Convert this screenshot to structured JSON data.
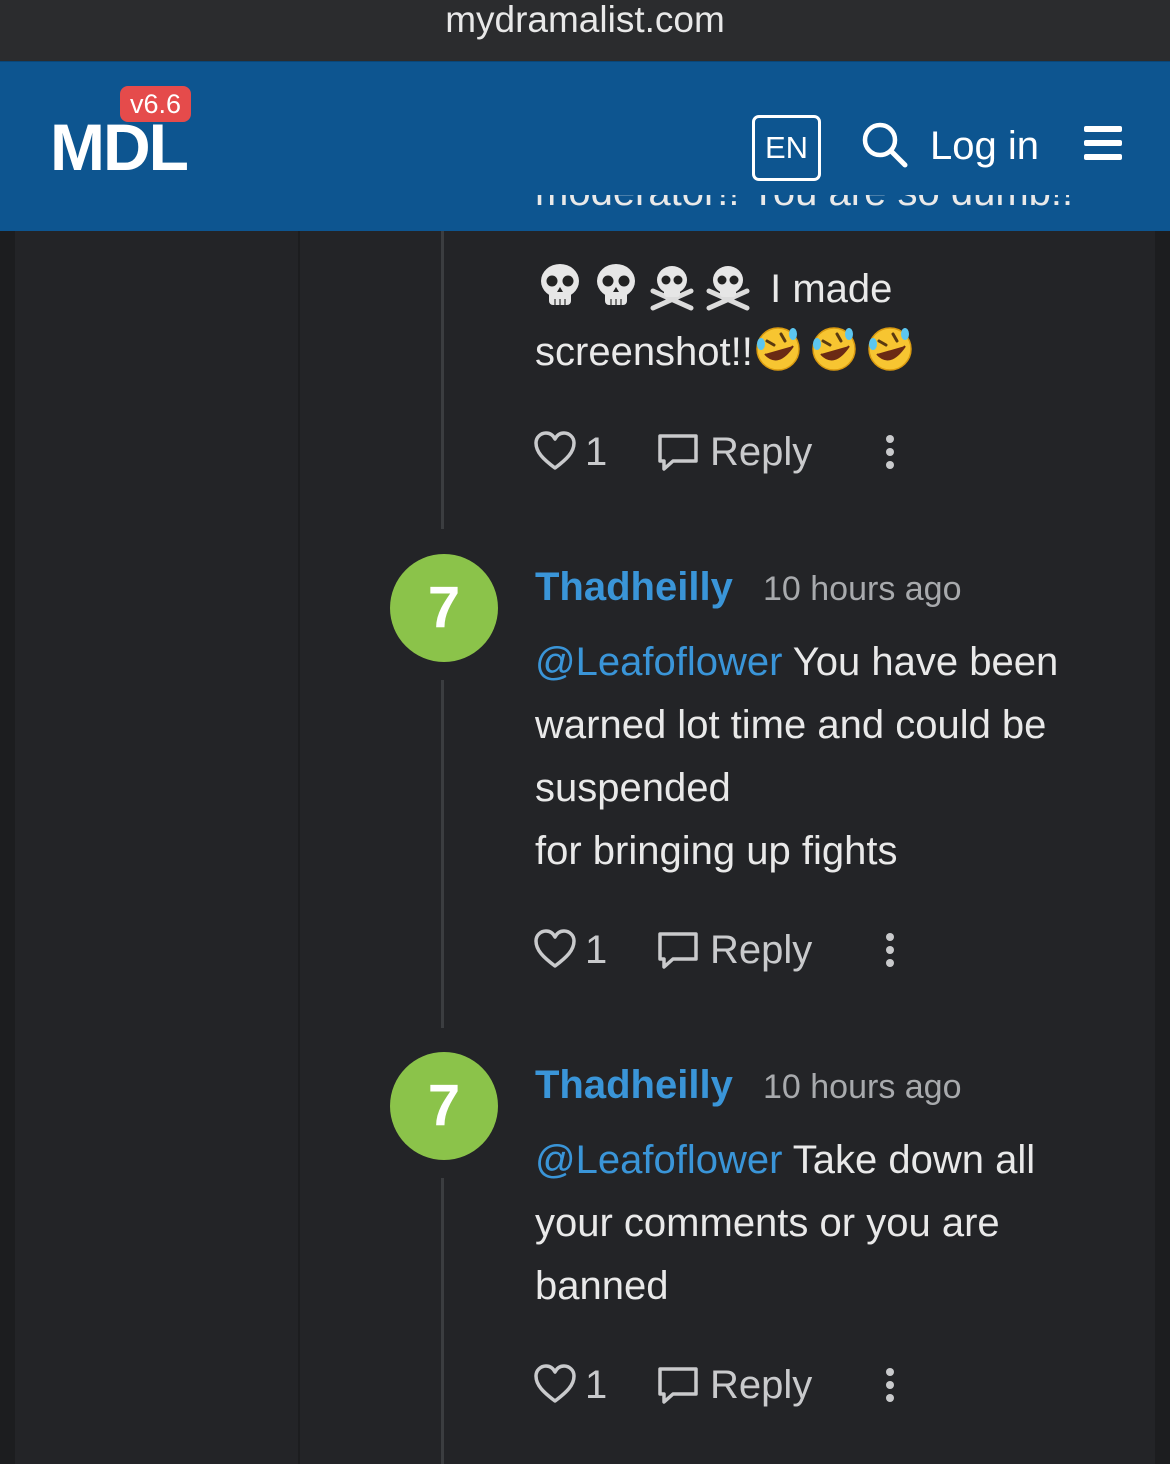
{
  "browser": {
    "url": "mydramalist.com"
  },
  "header": {
    "logo": "MDL",
    "version": "v6.6",
    "language": "EN",
    "login_label": "Log in"
  },
  "colors": {
    "header_bg": "#0d5590",
    "avatar_bg": "#8bc34a",
    "link": "#3a95d8",
    "badge": "#e54b4b"
  },
  "previous_comment": {
    "partial_text": "moderator!! You are so dumb!!",
    "emoji_line_text": " I made",
    "last_line_text": "screenshot!!",
    "emojis_line": [
      "skull",
      "skull",
      "skull-and-crossbones",
      "skull-and-crossbones"
    ],
    "emojis_end": [
      "rolling-on-floor-laughing",
      "rolling-on-floor-laughing",
      "rolling-on-floor-laughing"
    ],
    "likes": "1",
    "reply_label": "Reply"
  },
  "comments": [
    {
      "avatar": "7",
      "username": "Thadheilly",
      "timestamp": "10 hours ago",
      "mention": "@Leafoflower",
      "text_first": " You have been",
      "text_lines": [
        "warned lot time and could be",
        "suspended",
        "for bringing up fights"
      ],
      "likes": "1",
      "reply_label": "Reply"
    },
    {
      "avatar": "7",
      "username": "Thadheilly",
      "timestamp": "10 hours ago",
      "mention": "@Leafoflower",
      "text_first": " Take down all",
      "text_lines": [
        "your comments or you are",
        "banned"
      ],
      "likes": "1",
      "reply_label": "Reply"
    }
  ]
}
